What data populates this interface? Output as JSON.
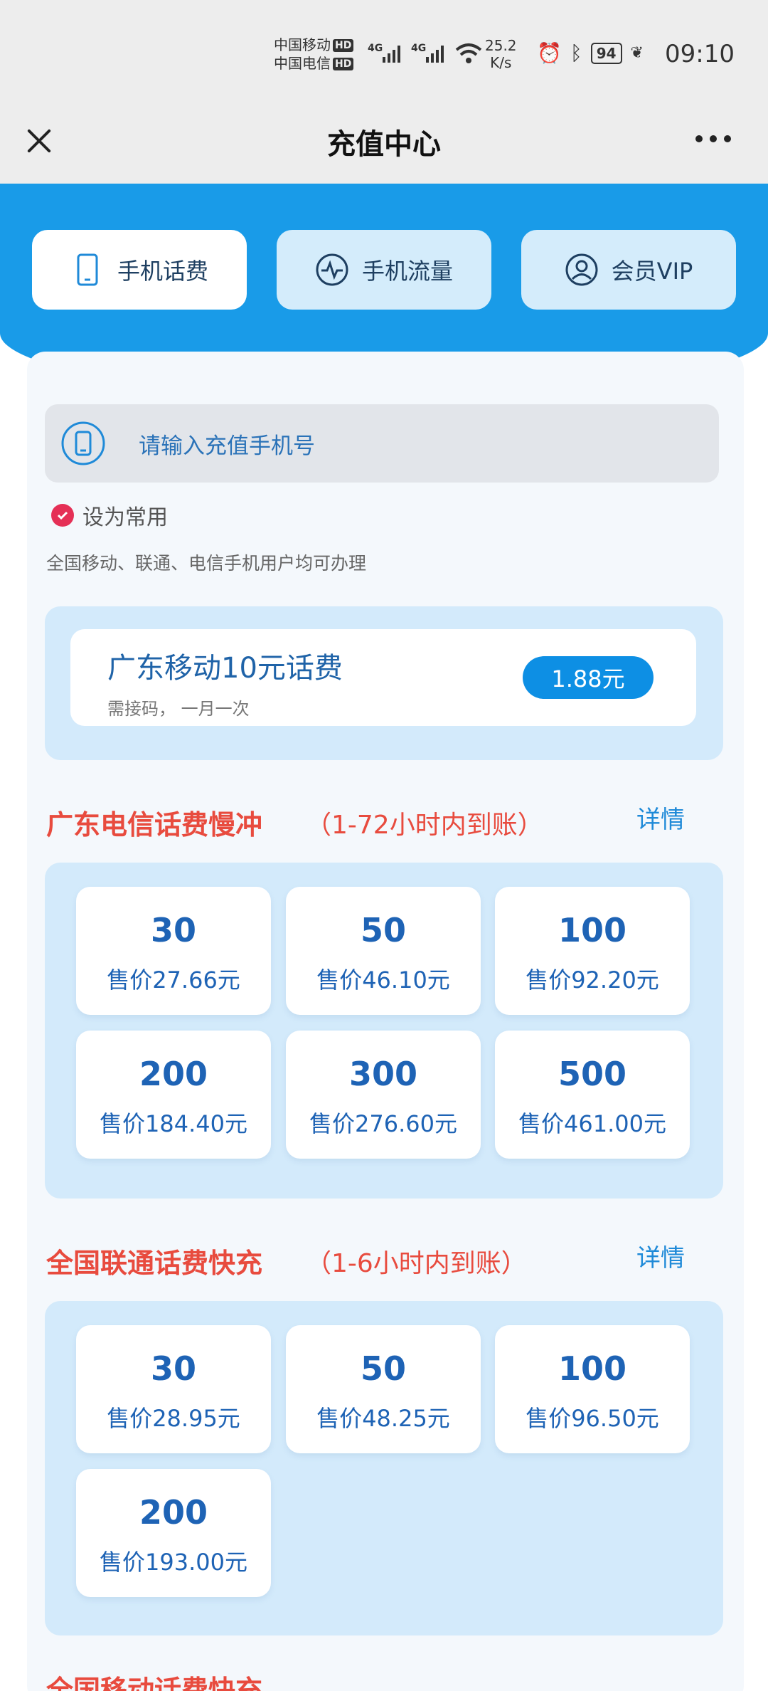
{
  "status_bar": {
    "carrier_1": "中国移动",
    "carrier_2": "中国电信",
    "hd": "HD",
    "net_1": "4G",
    "net_2": "4G",
    "speed_value": "25.2",
    "speed_unit": "K/s",
    "battery": "94",
    "time": "09:10"
  },
  "title_bar": {
    "title": "充值中心"
  },
  "tabs": [
    {
      "label": "手机话费",
      "icon": "phone-icon",
      "active": true
    },
    {
      "label": "手机流量",
      "icon": "pulse-icon",
      "active": false
    },
    {
      "label": "会员VIP",
      "icon": "user-icon",
      "active": false
    }
  ],
  "phone_input": {
    "placeholder": "请输入充值手机号"
  },
  "set_common": {
    "label": "设为常用",
    "checked": true
  },
  "note": "全国移动、联通、电信手机用户均可办理",
  "promo": {
    "title": "广东移动10元话费",
    "subtitle": "需接码， 一月一次",
    "price": "1.88元"
  },
  "sections": [
    {
      "title": "广东电信话费慢冲",
      "subtitle": "（1-72小时内到账）",
      "detail": "详情",
      "items": [
        {
          "amount": "30",
          "price": "售价27.66元"
        },
        {
          "amount": "50",
          "price": "售价46.10元"
        },
        {
          "amount": "100",
          "price": "售价92.20元"
        },
        {
          "amount": "200",
          "price": "售价184.40元"
        },
        {
          "amount": "300",
          "price": "售价276.60元"
        },
        {
          "amount": "500",
          "price": "售价461.00元"
        }
      ]
    },
    {
      "title": "全国联通话费快充",
      "subtitle": "（1-6小时内到账）",
      "detail": "详情",
      "items": [
        {
          "amount": "30",
          "price": "售价28.95元"
        },
        {
          "amount": "50",
          "price": "售价48.25元"
        },
        {
          "amount": "100",
          "price": "售价96.50元"
        },
        {
          "amount": "200",
          "price": "售价193.00元"
        }
      ]
    }
  ],
  "next_section": {
    "title": "全国移动话费快充"
  },
  "colors": {
    "header_blue": "#199be8",
    "section_title": "#e84b3e",
    "tile_text": "#1e63b5",
    "price_pill": "#0d8fe4",
    "check_red": "#e53056"
  }
}
